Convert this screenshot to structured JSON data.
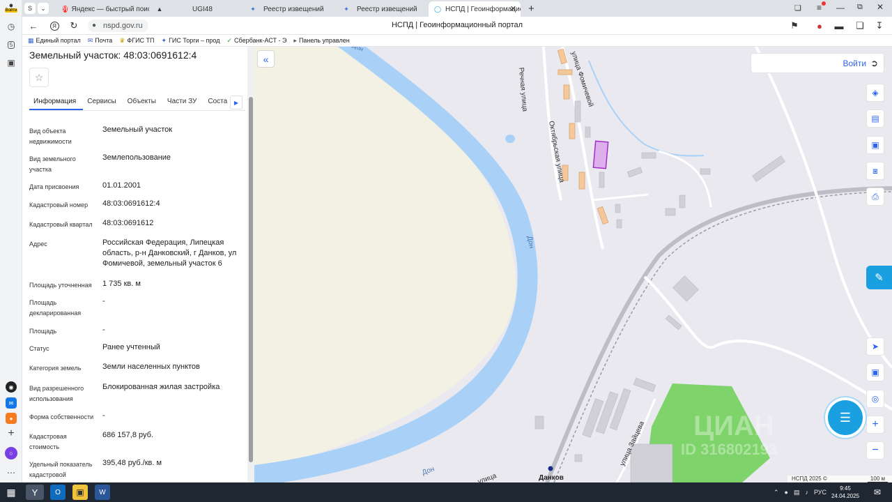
{
  "browser": {
    "login_badge": "Войти",
    "tabs": [
      {
        "label": "Яндекс — быстрый поиск",
        "icon": "yandex-icon"
      },
      {
        "label": "UGI48",
        "icon": "site-icon"
      },
      {
        "label": "Реестр извещений",
        "icon": "emblem-icon"
      },
      {
        "label": "Реестр извещений",
        "icon": "emblem-icon"
      },
      {
        "label": "НСПД | Геоинформационн",
        "icon": "nspd-icon"
      }
    ],
    "url": "nspd.gov.ru",
    "page_title": "НСПД | Геоинформационный портал",
    "bookmarks": [
      "Единый портал",
      "Почта",
      "ФГИС ТП",
      "ГИС Торги – прод",
      "Сбербанк-АСТ - Э",
      "Панель управлен"
    ]
  },
  "panel": {
    "title": "Земельный участок: 48:03:0691612:4",
    "tabs": [
      "Информация",
      "Сервисы",
      "Объекты",
      "Части ЗУ",
      "Соста"
    ],
    "rows": [
      {
        "label": "Вид объекта недвижимости",
        "value": "Земельный участок"
      },
      {
        "label": "Вид земельного участка",
        "value": "Землепользование"
      },
      {
        "label": "Дата присвоения",
        "value": "01.01.2001"
      },
      {
        "label": "Кадастровый номер",
        "value": "48:03:0691612:4"
      },
      {
        "label": "Кадастровый квартал",
        "value": "48:03:0691612"
      },
      {
        "label": "Адрес",
        "value": "Российская Федерация, Липецкая область, р-н Данковский, г Данков, ул Фомичевой, земельный участок 6"
      },
      {
        "label": "Площадь уточненная",
        "value": "1 735 кв. м"
      },
      {
        "label": "Площадь декларированная",
        "value": "-"
      },
      {
        "label": "Площадь",
        "value": "-"
      },
      {
        "label": "Статус",
        "value": "Ранее учтенный"
      },
      {
        "label": "Категория земель",
        "value": "Земли населенных пунктов"
      },
      {
        "label": "Вид разрешенного использования",
        "value": "Блокированная жилая застройка"
      },
      {
        "label": "Форма собственности",
        "value": "-"
      },
      {
        "label": "Кадастровая стоимость",
        "value": "686 157,8 руб."
      },
      {
        "label": "Удельный показатель кадастровой",
        "value": "395,48 руб./кв. м"
      }
    ]
  },
  "map": {
    "login_label": "Войти",
    "labels": {
      "street_fomicheva": "улица Фомичевой",
      "street_rechnaya": "Речная улица",
      "street_oktyabrskaya": "Октябрьская улица",
      "street_zaitseva": "улица Зайцева",
      "street_ulitsa": "улица",
      "river_1": "Дон",
      "river_2": "Дон",
      "river_3": "Дон",
      "town": "Данков"
    },
    "watermark_1": "ЦИАН",
    "watermark_2": "ID 316802193",
    "attribution": "НСПД 2025 ©",
    "scale": "100 м",
    "colors": {
      "river": "#a9d1f7",
      "field": "#f2f1e4",
      "urban": "#e9e9ef",
      "parcel": "#d58be8",
      "green": "#7ed36b",
      "accent": "#2c62f0"
    }
  },
  "taskbar": {
    "lang": "РУС",
    "time": "9:45",
    "date": "24.04.2025"
  }
}
